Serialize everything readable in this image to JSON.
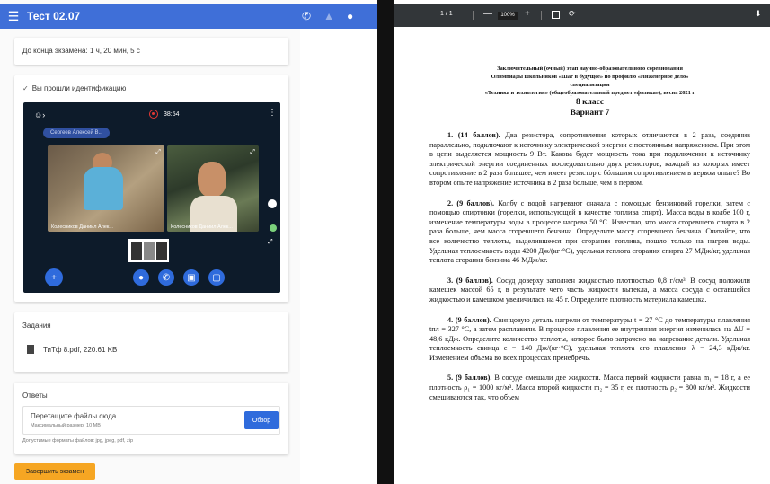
{
  "app": {
    "title": "Тест 02.07",
    "timer_text": "До конца экзамена: 1 ч, 20 мин, 5 с",
    "ident_text": "Вы прошли идентификацию",
    "video": {
      "time": "38:54",
      "chip": "Сергеев Алексей В...",
      "tile1_name": "Колесников Даниил Алек...",
      "tile2_name": "Колесников Даниил Алек..."
    },
    "tasks_section": {
      "title": "Задания",
      "file": "ТиТф 8.pdf, 220.61 KB"
    },
    "answers_section": {
      "title": "Ответы",
      "drop_text": "Перетащите файлы сюда",
      "max_size": "Максимальный размер: 10 MB",
      "browse_label": "Обзор",
      "formats": "Допустимые форматы файлов: jpg, jpeg, pdf, zip"
    },
    "finish_label": "Завершить экзамен"
  },
  "pdf": {
    "page": "1 / 1",
    "zoom": "100%",
    "header1": "Заключительный (очный) этап научно-образовательного соревнования",
    "header2": "Олимпиады школьников «Шаг в будущее» по профилю «Инженерное дело»",
    "header3": "специализации",
    "header4": "«Техника и технологии» (общеобразовательный предмет «физика»), весна 2021 г",
    "grade": "8 класс",
    "variant": "Вариант 7",
    "tasks": [
      {
        "head": "1. (14 баллов).",
        "text": "Два резистора, сопротивления которых отличаются в 2 раза, соединив параллельно, подключают к источнику электрической энергии с постоянным напряжением. При этом в цепи выделяется мощность 9 Вт. Какова будет мощность тока при подключении к источнику электрической энергии соединенных последовательно двух резисторов, каждый из которых имеет сопротивление в 2 раза большее, чем имеет резистор с бóльшим сопротивлением в первом опыте? Во втором опыте напряжение источника в 2 раза больше, чем в первом."
      },
      {
        "head": "2. (9 баллов).",
        "text": "Колбу с водой нагревают сначала с помощью бензиновой горелки, затем с помощью спиртовки (горелки, использующей в качестве топлива спирт). Масса воды в колбе 100 г, изменение температуры воды в процессе нагрева 50 °С. Известно, что масса сгоревшего спирта в 2 раза больше, чем масса сгоревшего бензина. Определите массу сгоревшего бензина. Считайте, что все количество теплоты, выделившееся при сгорании топлива, пошло только на нагрев воды. Удельная теплоемкость воды 4200 Дж/(кг·°С), удельная теплота сгорания спирта 27 МДж/кг, удельная теплота сгорания бензина 46 МДж/кг."
      },
      {
        "head": "3. (9 баллов).",
        "text": "Сосуд доверху заполнен жидкостью плотностью 0,8 г/см³. В сосуд положили камешек массой 65 г, в результате чего часть жидкости вытекла, а масса сосуда с оставшейся жидкостью и камешком увеличилась на 45 г. Определите плотность материала камешка."
      },
      {
        "head": "4. (9 баллов).",
        "text": "Свинцовую деталь нагрели от температуры t = 27 °С до температуры плавления tпл = 327 °С, а затем расплавили. В процессе плавления ее внутренняя энергия изменилась на ΔU = 48,6 кДж. Определите количество теплоты, которое было затрачено на нагревание детали. Удельная теплоемкость свинца c = 140 Дж/(кг·°С), удельная теплота его плавления λ = 24,3 кДж/кг. Изменением объема во всех процессах пренебречь."
      },
      {
        "head": "5. (9 баллов).",
        "text": "В сосуде смешали две жидкости. Масса первой жидкости равна m₁ = 18 г, а ее плотность ρ₁ = 1000 кг/м³. Масса второй жидкости m₂ = 35 г, ее плотность ρ₂ = 800 кг/м³. Жидкости смешиваются так, что объем"
      }
    ]
  },
  "colors": {
    "appbar": "#3f6fd8",
    "primary_button": "#2f6bdc",
    "finish_button": "#f6a623",
    "pdf_toolbar": "#323639"
  }
}
